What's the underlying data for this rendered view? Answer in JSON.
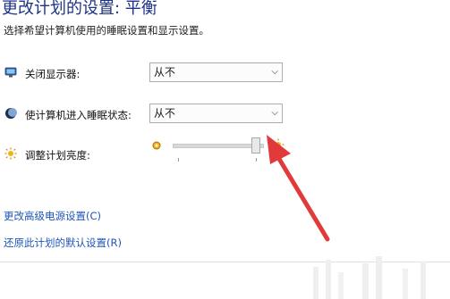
{
  "header": {
    "title": "更改计划的设置: 平衡",
    "subtitle": "选择希望计算机使用的睡眠设置和显示设置。"
  },
  "settings": {
    "display_off": {
      "label": "关闭显示器:",
      "value": "从不",
      "icon": "monitor-icon"
    },
    "sleep": {
      "label": "使计算机进入睡眠状态:",
      "value": "从不",
      "icon": "moon-icon"
    },
    "brightness": {
      "label": "调整计划亮度:",
      "level_percent": 94,
      "icon": "sun-icon"
    }
  },
  "links": {
    "advanced": "更改高级电源设置(C)",
    "restore": "还原此计划的默认设置(R)"
  },
  "colors": {
    "title": "#1e3287",
    "link": "#1f55b8",
    "annotation_arrow": "#e23a3a"
  }
}
